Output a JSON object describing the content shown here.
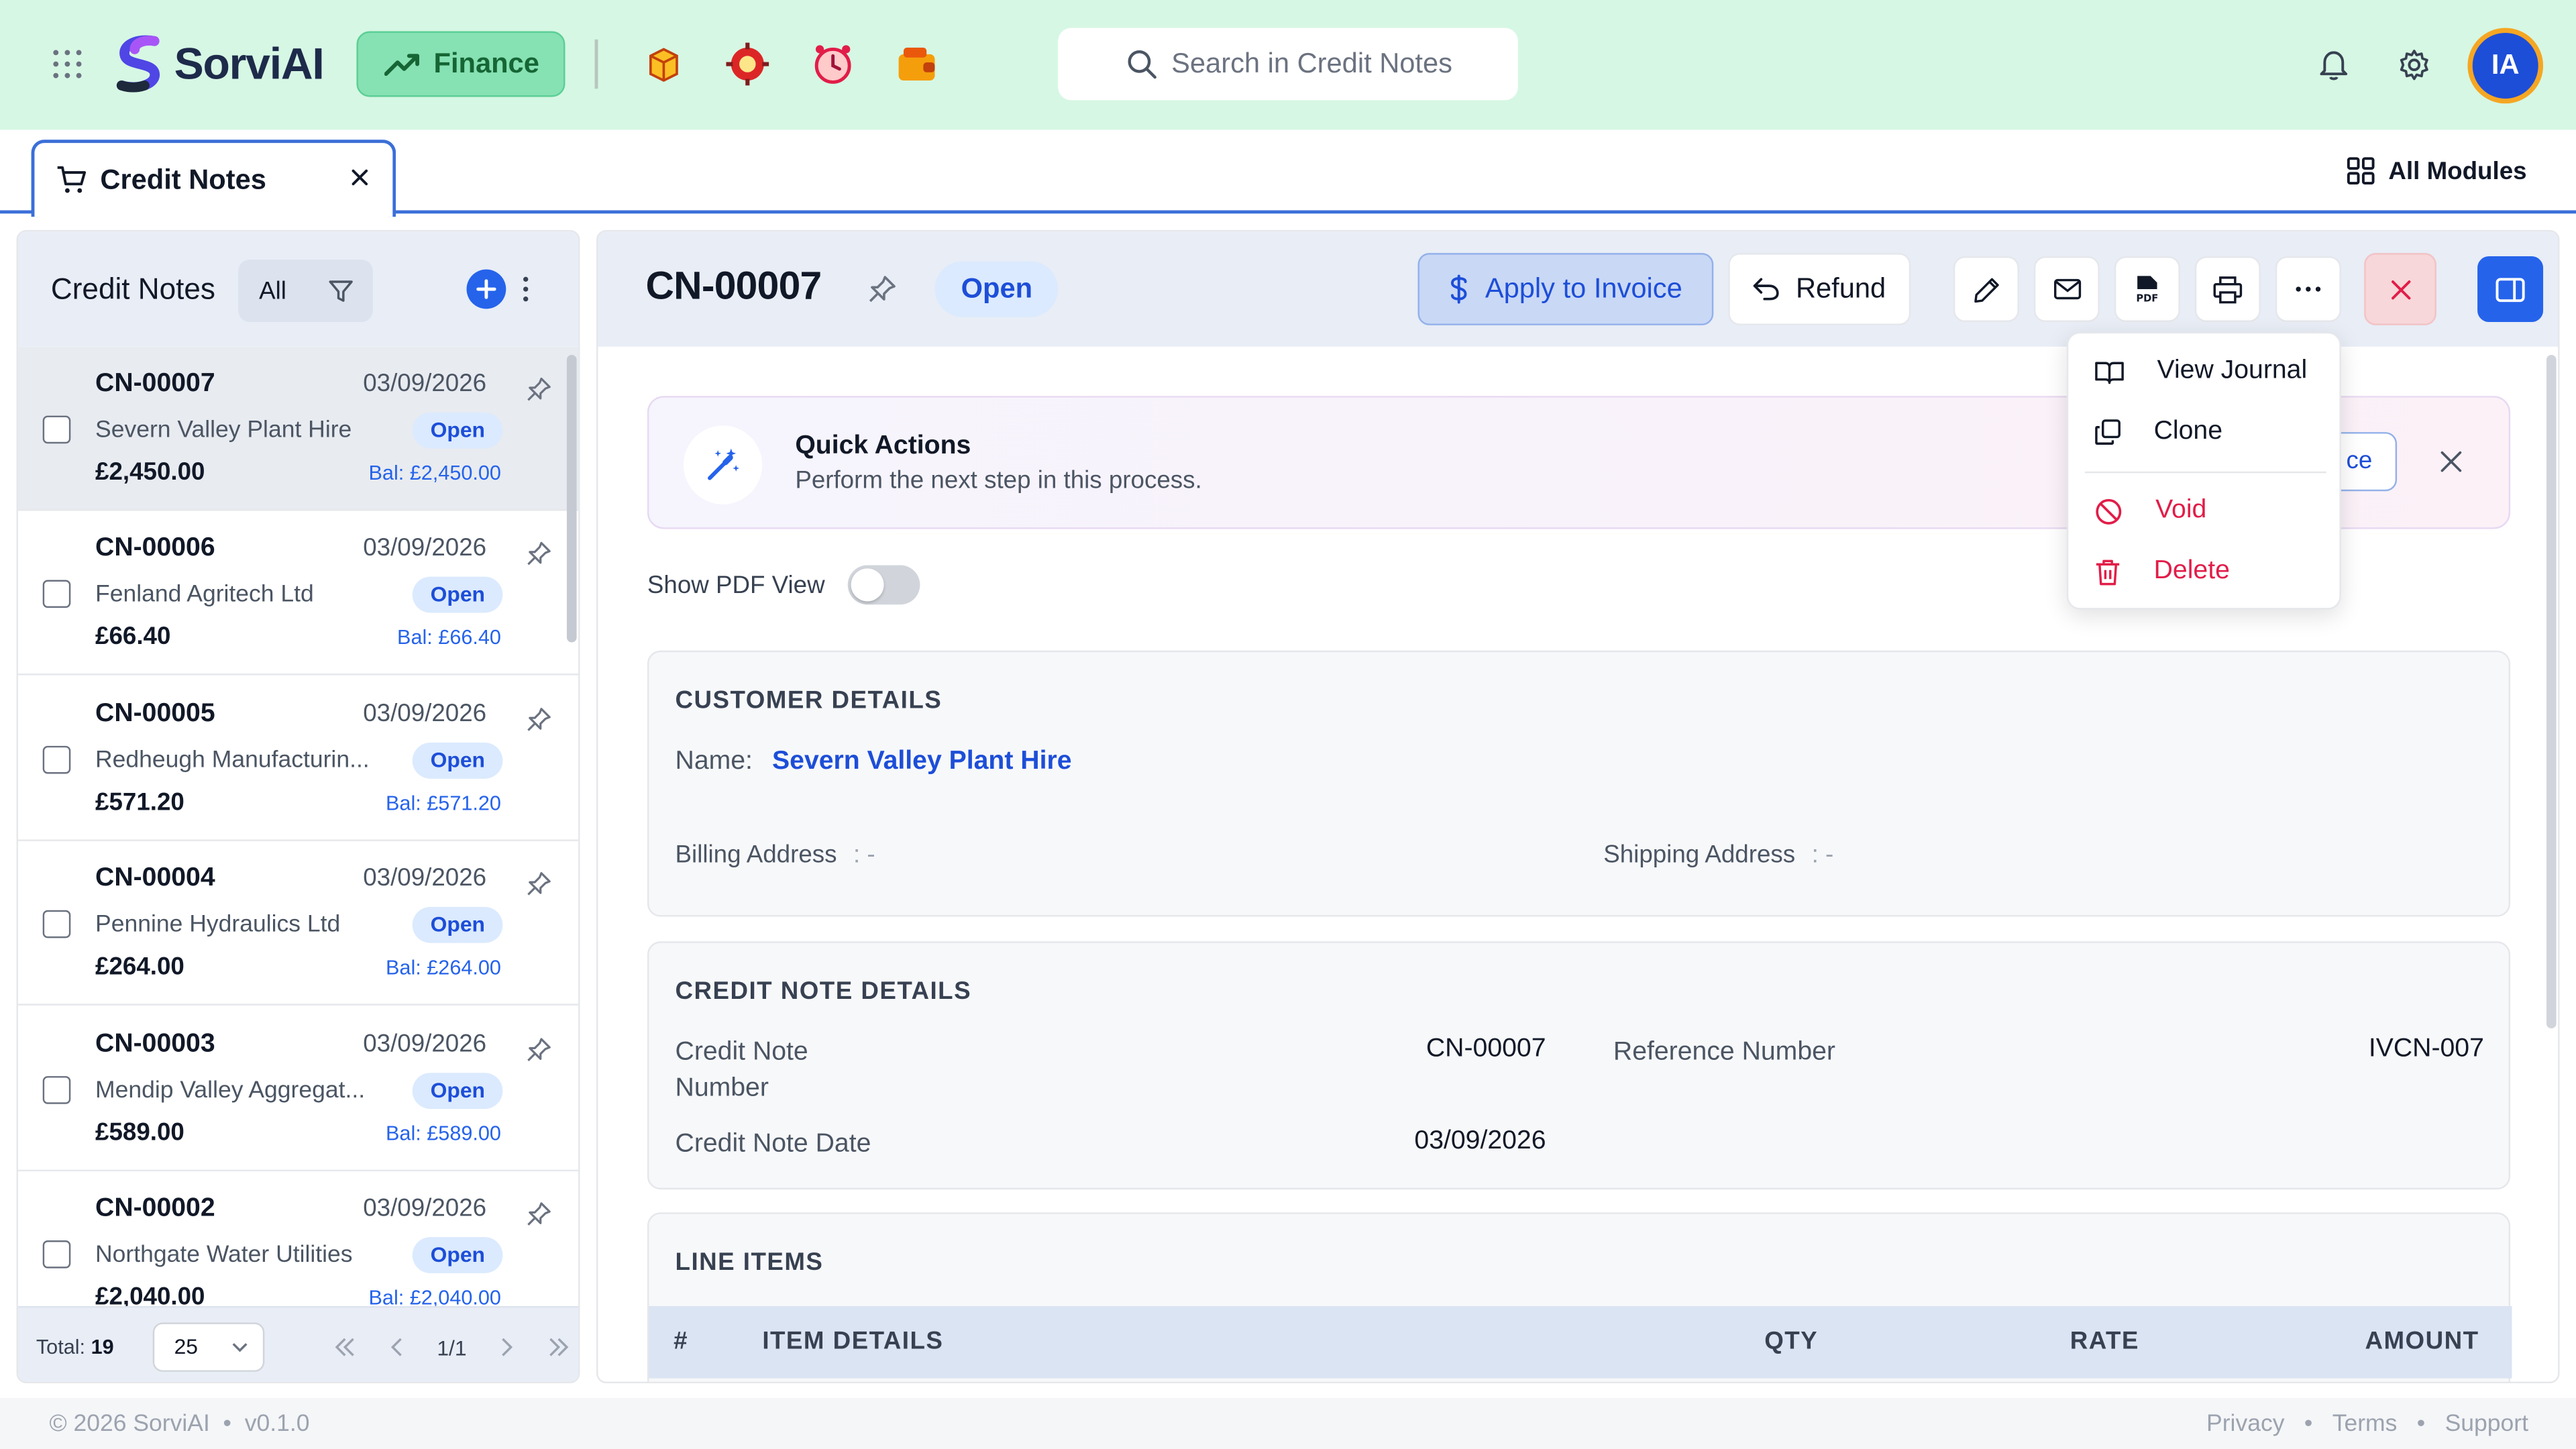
{
  "topbar": {
    "brand": "SorviAI",
    "module": "Finance",
    "search_placeholder": "Search in Credit Notes",
    "avatar_initials": "IA"
  },
  "tabs": {
    "active_tab": "Credit Notes",
    "all_modules": "All Modules"
  },
  "list": {
    "title": "Credit Notes",
    "filter": "All",
    "rows": [
      {
        "number": "CN-00007",
        "date": "03/09/2026",
        "customer": "Severn Valley Plant Hire",
        "status": "Open",
        "amount": "£2,450.00",
        "balance": "Bal: £2,450.00"
      },
      {
        "number": "CN-00006",
        "date": "03/09/2026",
        "customer": "Fenland Agritech Ltd",
        "status": "Open",
        "amount": "£66.40",
        "balance": "Bal: £66.40"
      },
      {
        "number": "CN-00005",
        "date": "03/09/2026",
        "customer": "Redheugh Manufacturin...",
        "status": "Open",
        "amount": "£571.20",
        "balance": "Bal: £571.20"
      },
      {
        "number": "CN-00004",
        "date": "03/09/2026",
        "customer": "Pennine Hydraulics Ltd",
        "status": "Open",
        "amount": "£264.00",
        "balance": "Bal: £264.00"
      },
      {
        "number": "CN-00003",
        "date": "03/09/2026",
        "customer": "Mendip Valley Aggregat...",
        "status": "Open",
        "amount": "£589.00",
        "balance": "Bal: £589.00"
      },
      {
        "number": "CN-00002",
        "date": "03/09/2026",
        "customer": "Northgate Water Utilities",
        "status": "Open",
        "amount": "£2,040.00",
        "balance": "Bal: £2,040.00"
      }
    ],
    "footer": {
      "total_label": "Total:",
      "total_value": "19",
      "per_page": "25",
      "pages": "1/1"
    }
  },
  "detail": {
    "title": "CN-00007",
    "status": "Open",
    "apply_label": "Apply to Invoice",
    "refund_label": "Refund",
    "quick_actions": {
      "title": "Quick Actions",
      "subtitle": "Perform the next step in this process.",
      "action_fragment": "ce"
    },
    "show_pdf_label": "Show PDF View",
    "customer": {
      "heading": "CUSTOMER DETAILS",
      "name_label": "Name:",
      "name": "Severn Valley Plant Hire",
      "billing_label": "Billing Address",
      "billing_value": ": -",
      "shipping_label": "Shipping Address",
      "shipping_value": ": -"
    },
    "credit_note": {
      "heading": "CREDIT NOTE DETAILS",
      "number_label_1": "Credit Note",
      "number_label_2": "Number",
      "number_value": "CN-00007",
      "ref_label": "Reference Number",
      "ref_value": "IVCN-007",
      "date_label": "Credit Note Date",
      "date_value": "03/09/2026"
    },
    "line_items": {
      "heading": "LINE ITEMS",
      "columns": [
        "#",
        "ITEM DETAILS",
        "QTY",
        "RATE",
        "AMOUNT"
      ]
    }
  },
  "menu": {
    "view_journal": "View Journal",
    "clone": "Clone",
    "void": "Void",
    "delete": "Delete"
  },
  "footer": {
    "copyright": "© 2026 SorviAI",
    "version": "v0.1.0",
    "links": [
      "Privacy",
      "Terms",
      "Support"
    ]
  },
  "colors": {
    "topbar_bg": "#d6f7e4",
    "accent_blue": "#2563eb",
    "danger": "#e11d48",
    "module_chip": "#86e1b3"
  }
}
